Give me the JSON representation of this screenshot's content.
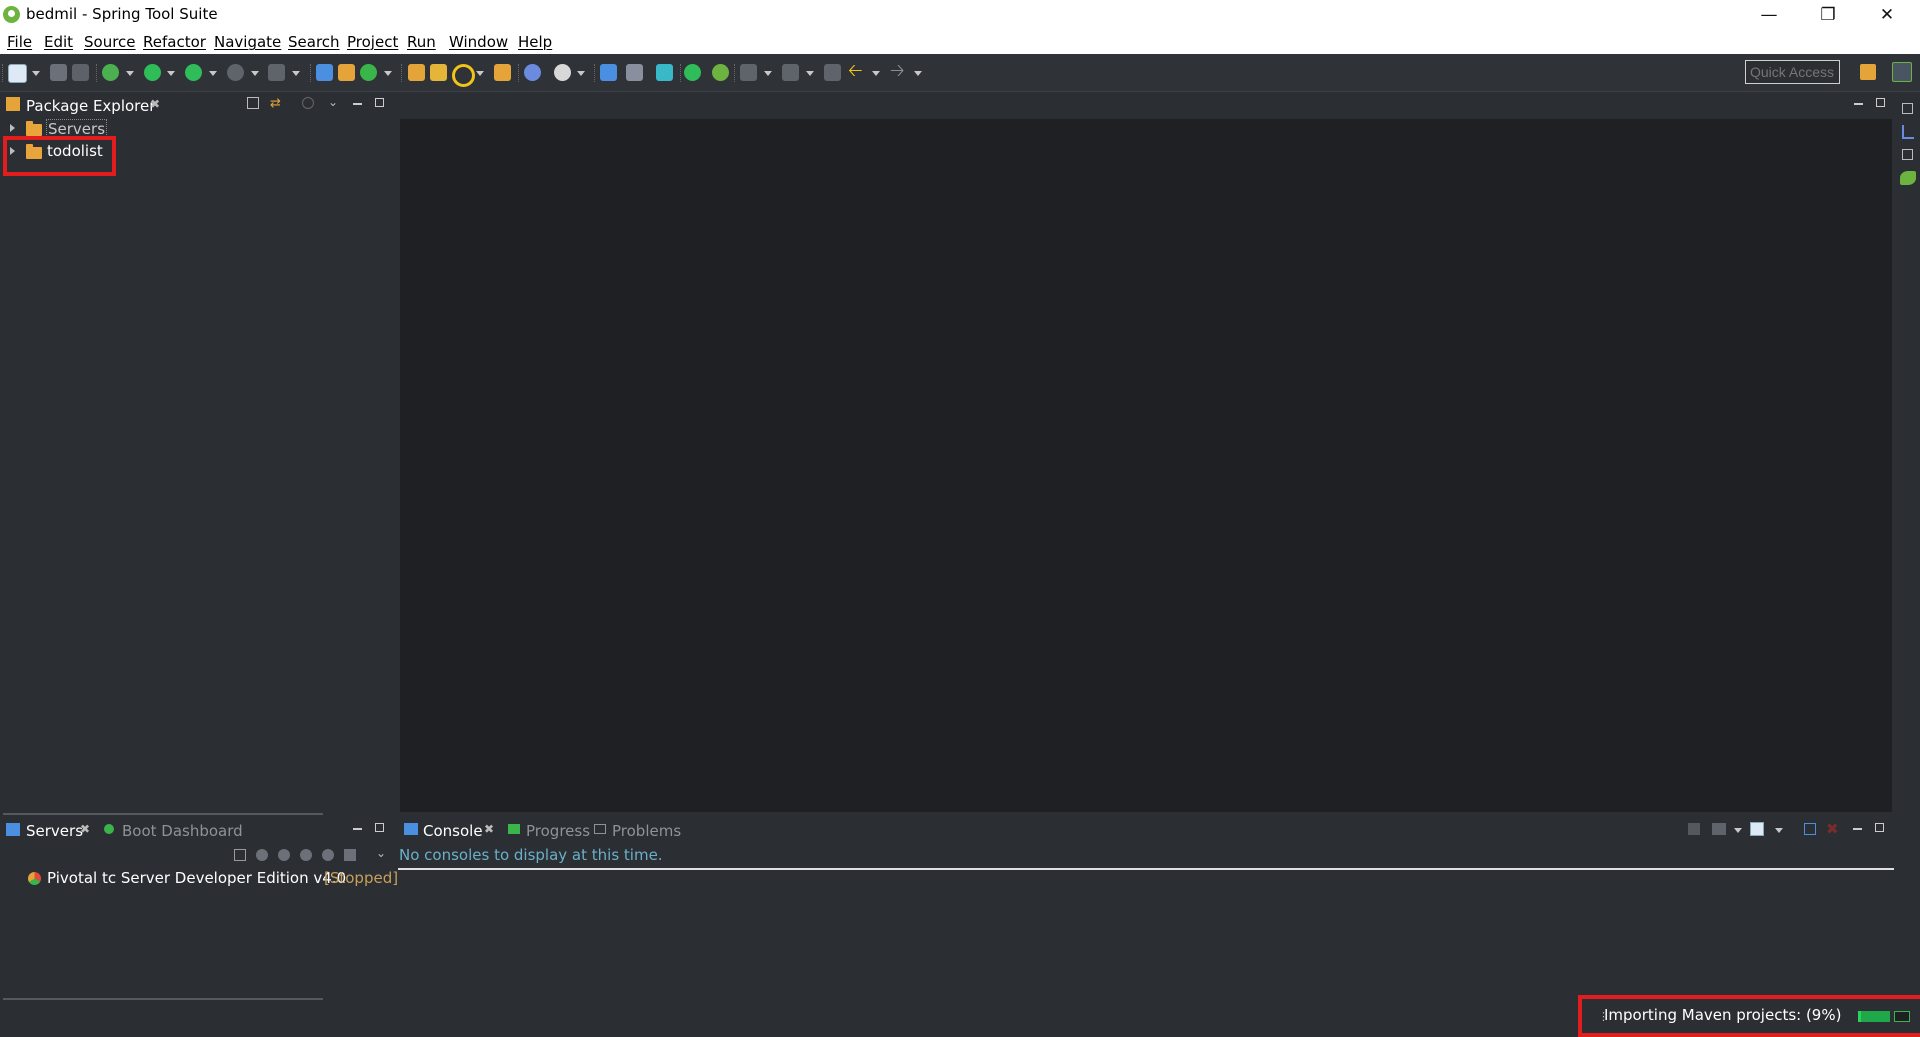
{
  "window": {
    "title": "bedmil - Spring Tool Suite",
    "minimize": "—",
    "restore": "❐",
    "close": "✕"
  },
  "menu": [
    "File",
    "Edit",
    "Source",
    "Refactor",
    "Navigate",
    "Search",
    "Project",
    "Run",
    "Window",
    "Help"
  ],
  "toolbar": {
    "quick_access_placeholder": "Quick Access"
  },
  "package_explorer": {
    "tab_label": "Package Explorer",
    "items": [
      {
        "label": "Servers",
        "icon": "folder-icon"
      },
      {
        "label": "todolist",
        "icon": "folder-icon"
      }
    ]
  },
  "servers_view": {
    "tabs": [
      "Servers",
      "Boot Dashboard"
    ],
    "server": {
      "name": "Pivotal tc Server Developer Edition v4.0",
      "state": "[Stopped]"
    }
  },
  "console_view": {
    "tabs": [
      "Console",
      "Progress",
      "Problems"
    ],
    "message": "No consoles to display at this time."
  },
  "status_bar": {
    "progress_text": "Importing Maven projects: (9%)",
    "progress_fraction": 0.09
  },
  "colors": {
    "background": "#2b2e33",
    "editor": "#1e2023",
    "highlight": "#e11d1d",
    "link_text": "#6ab0c8",
    "stopped": "#c7a05a"
  }
}
